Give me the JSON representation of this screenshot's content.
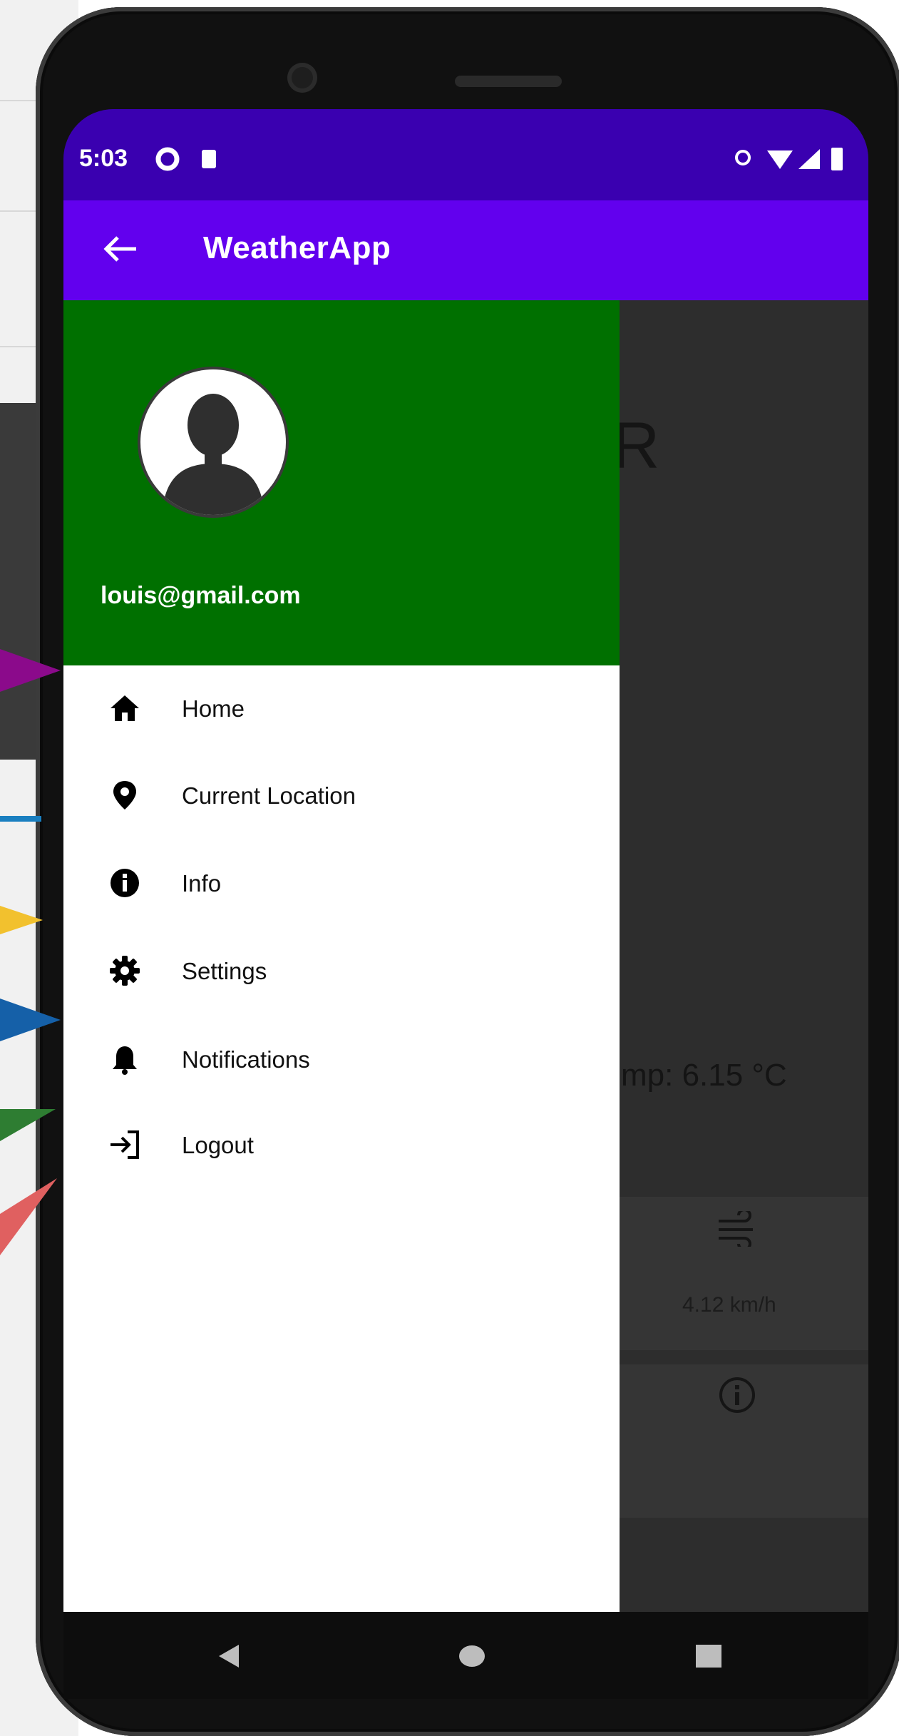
{
  "statusbar": {
    "time": "5:03"
  },
  "appbar": {
    "title": "WeatherApp"
  },
  "drawer": {
    "email": "louis@gmail.com",
    "items": [
      {
        "label": "Home",
        "icon": "home-icon"
      },
      {
        "label": "Current Location",
        "icon": "location-pin-icon"
      },
      {
        "label": "Info",
        "icon": "info-icon"
      },
      {
        "label": "Settings",
        "icon": "gear-icon"
      },
      {
        "label": "Notifications",
        "icon": "bell-icon"
      },
      {
        "label": "Logout",
        "icon": "logout-icon"
      }
    ]
  },
  "content": {
    "partial_letter": "R",
    "temp_text": "mp: 6.15 °C",
    "wind_text": "4.12 km/h"
  },
  "colors": {
    "statusbar": "#3a00b0",
    "appbar": "#6200ee",
    "drawer_header": "#007000",
    "arrow_purple": "#8b0a8b",
    "arrow_blue": "#1a7fc0",
    "arrow_yellow": "#f2c12e",
    "arrow_navy": "#1560a8",
    "arrow_green": "#2e7d32",
    "arrow_red": "#e06060"
  }
}
